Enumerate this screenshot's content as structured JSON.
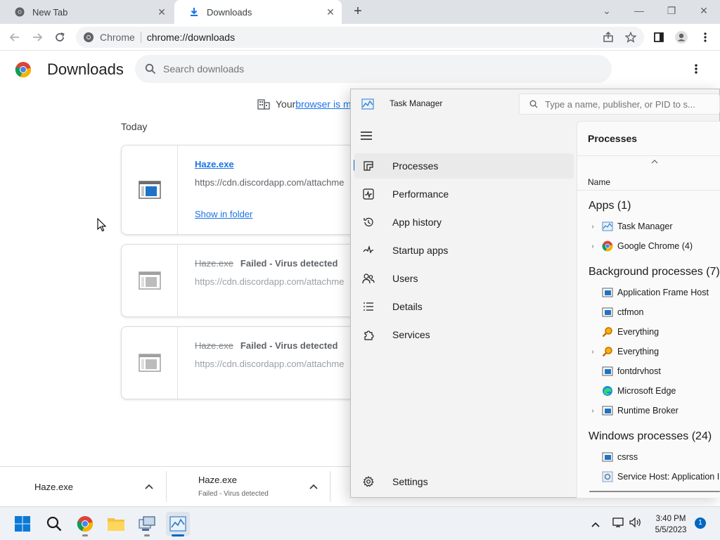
{
  "browser": {
    "tabs": [
      {
        "title": "New Tab"
      },
      {
        "title": "Downloads"
      }
    ],
    "omnibox": {
      "site": "Chrome",
      "url": "chrome://downloads"
    }
  },
  "downloads_page": {
    "title": "Downloads",
    "search_placeholder": "Search downloads",
    "managed_prefix": "Your ",
    "managed_link": "browser is ma",
    "section_today": "Today",
    "items": [
      {
        "name": "Haze.exe",
        "url": "https://cdn.discordapp.com/attachme",
        "action": "Show in folder"
      },
      {
        "name": "Haze.exe",
        "status": "Failed - Virus detected",
        "url": "https://cdn.discordapp.com/attachme"
      },
      {
        "name": "Haze.exe",
        "status": "Failed - Virus detected",
        "url": "https://cdn.discordapp.com/attachme"
      }
    ]
  },
  "shelf": {
    "items": [
      {
        "name": "Haze.exe",
        "sub": ""
      },
      {
        "name": "Haze.exe",
        "sub": "Failed - Virus detected"
      }
    ]
  },
  "task_manager": {
    "title": "Task Manager",
    "search_placeholder": "Type a name, publisher, or PID to s...",
    "nav": [
      "Processes",
      "Performance",
      "App history",
      "Startup apps",
      "Users",
      "Details",
      "Services"
    ],
    "settings": "Settings",
    "content_title": "Processes",
    "column_name": "Name",
    "groups": [
      {
        "label": "Apps (1)"
      },
      {
        "label": "Background processes (7)"
      },
      {
        "label": "Windows processes (24)"
      }
    ],
    "apps": [
      "Task Manager",
      "Google Chrome (4)"
    ],
    "background": [
      "Application Frame Host",
      "ctfmon",
      "Everything",
      "Everything",
      "fontdrvhost",
      "Microsoft Edge",
      "Runtime Broker"
    ],
    "windows": [
      "csrss",
      "Service Host: Application In"
    ]
  },
  "taskbar": {
    "time": "3:40 PM",
    "date": "5/5/2023",
    "notifications": "1"
  },
  "colors": {
    "accent": "#1a73e8",
    "win_accent": "#0067c0"
  }
}
